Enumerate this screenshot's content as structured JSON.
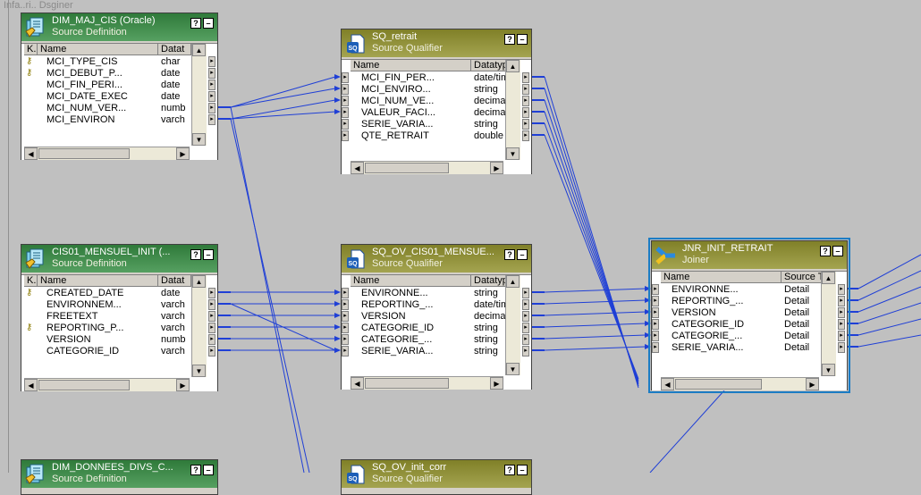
{
  "canvas": {
    "edge_label": "Infa..ri.. Dsginer",
    "wire_color": "#1f3fd6"
  },
  "transforms": [
    {
      "id": "dim_maj_cis",
      "kind": "src",
      "icon": "source-definition-icon",
      "title": "DIM_MAJ_CIS (Oracle)",
      "subtitle": "Source Definition",
      "columns": [
        "K.",
        "Name",
        "Datat"
      ],
      "rows": [
        {
          "key": true,
          "name": "MCI_TYPE_CIS",
          "type": "char"
        },
        {
          "key": true,
          "name": "MCI_DEBUT_P...",
          "type": "date"
        },
        {
          "key": false,
          "name": "MCI_FIN_PERI...",
          "type": "date"
        },
        {
          "key": false,
          "name": "MCI_DATE_EXEC",
          "type": "date"
        },
        {
          "key": false,
          "name": "MCI_NUM_VER...",
          "type": "numb"
        },
        {
          "key": false,
          "name": "MCI_ENVIRON",
          "type": "varch"
        }
      ]
    },
    {
      "id": "sq_retrait",
      "kind": "sq",
      "icon": "source-qualifier-icon",
      "title": "SQ_retrait",
      "subtitle": "Source Qualifier",
      "columns": [
        "Name",
        "Datatype"
      ],
      "rows": [
        {
          "name": "MCI_FIN_PER...",
          "type": "date/time"
        },
        {
          "name": "MCI_ENVIRO...",
          "type": "string"
        },
        {
          "name": "MCI_NUM_VE...",
          "type": "decimal"
        },
        {
          "name": "VALEUR_FACI...",
          "type": "decimal"
        },
        {
          "name": "SERIE_VARIA...",
          "type": "string"
        },
        {
          "name": "QTE_RETRAIT",
          "type": "double"
        }
      ]
    },
    {
      "id": "cis01_mensuel",
      "kind": "src",
      "icon": "source-definition-icon",
      "title": "CIS01_MENSUEL_INIT (...",
      "subtitle": "Source Definition",
      "columns": [
        "K.",
        "Name",
        "Datat"
      ],
      "rows": [
        {
          "key": true,
          "name": "CREATED_DATE",
          "type": "date"
        },
        {
          "key": false,
          "name": "ENVIRONNEM...",
          "type": "varch"
        },
        {
          "key": false,
          "name": "FREETEXT",
          "type": "varch"
        },
        {
          "key": true,
          "name": "REPORTING_P...",
          "type": "varch"
        },
        {
          "key": false,
          "name": "VERSION",
          "type": "numb"
        },
        {
          "key": false,
          "name": "CATEGORIE_ID",
          "type": "varch"
        }
      ]
    },
    {
      "id": "sq_ov_cis01",
      "kind": "sq",
      "icon": "source-qualifier-icon",
      "title": "SQ_OV_CIS01_MENSUE...",
      "subtitle": "Source Qualifier",
      "columns": [
        "Name",
        "Datatype"
      ],
      "rows": [
        {
          "name": "ENVIRONNE...",
          "type": "string"
        },
        {
          "name": "REPORTING_...",
          "type": "date/time"
        },
        {
          "name": "VERSION",
          "type": "decimal"
        },
        {
          "name": "CATEGORIE_ID",
          "type": "string"
        },
        {
          "name": "CATEGORIE_...",
          "type": "string"
        },
        {
          "name": "SERIE_VARIA...",
          "type": "string"
        }
      ]
    },
    {
      "id": "jnr_init_retrait",
      "kind": "jnr",
      "icon": "joiner-icon",
      "title": "JNR_INIT_RETRAIT",
      "subtitle": "Joiner",
      "columns": [
        "Name",
        "Source T"
      ],
      "rows": [
        {
          "name": "ENVIRONNE...",
          "type": "Detail"
        },
        {
          "name": "REPORTING_...",
          "type": "Detail"
        },
        {
          "name": "VERSION",
          "type": "Detail"
        },
        {
          "name": "CATEGORIE_ID",
          "type": "Detail"
        },
        {
          "name": "CATEGORIE_...",
          "type": "Detail"
        },
        {
          "name": "SERIE_VARIA...",
          "type": "Detail"
        }
      ]
    },
    {
      "id": "dim_donnees",
      "kind": "src",
      "icon": "source-definition-icon",
      "title": "DIM_DONNEES_DIVS_C...",
      "subtitle": "Source Definition",
      "columns": [],
      "rows": []
    },
    {
      "id": "sq_ov_init_corr",
      "kind": "sq",
      "icon": "source-qualifier-icon",
      "title": "SQ_OV_init_corr",
      "subtitle": "Source Qualifier",
      "columns": [],
      "rows": []
    }
  ]
}
